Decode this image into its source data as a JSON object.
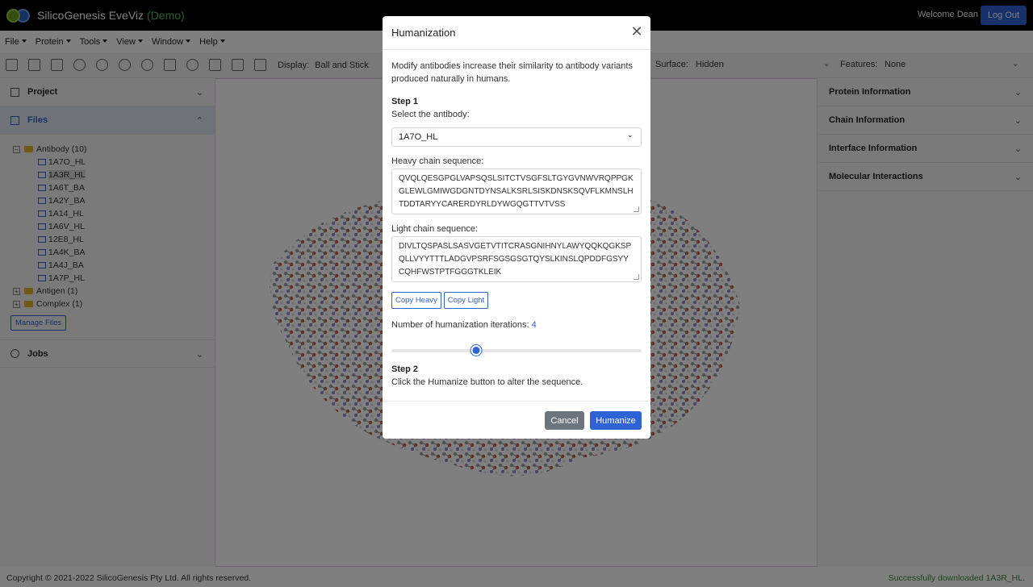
{
  "app": {
    "title": "SilicoGenesis EveViz",
    "tag": "(Demo)",
    "welcome": "Welcome Dean",
    "logout_label": "Log Out"
  },
  "menu": [
    "File",
    "Protein",
    "Tools",
    "View",
    "Window",
    "Help"
  ],
  "toolbar": {
    "display_label": "Display:",
    "display_value": "Ball and Stick",
    "surface_label": "Surface:",
    "surface_value": "Hidden",
    "features_label": "Features:",
    "features_value": "None"
  },
  "left_panel": {
    "project_label": "Project",
    "files_label": "Files",
    "jobs_label": "Jobs",
    "manage_files_label": "Manage Files",
    "tree": {
      "antibody_folder": "Antibody (10)",
      "antibody_files": [
        "1A7O_HL",
        "1A3R_HL",
        "1A6T_BA",
        "1A2Y_BA",
        "1A14_HL",
        "1A6V_HL",
        "12E8_HL",
        "1A4K_BA",
        "1A4J_BA",
        "1A7P_HL"
      ],
      "antigen_folder": "Antigen (1)",
      "complex_folder": "Complex (1)"
    }
  },
  "right_panel": {
    "sections": [
      "Protein Information",
      "Chain Information",
      "Interface Information",
      "Molecular Interactions"
    ]
  },
  "footer": {
    "copyright": "Copyright © 2021-2022 SilicoGenesis Pty Ltd. All rights reserved.",
    "status": "Successfully downloaded 1A3R_HL."
  },
  "modal": {
    "title": "Humanization",
    "description": "Modify antibodies increase their similarity to antibody variants produced naturally in humans.",
    "step1_title": "Step 1",
    "step1_text": "Select the antibody:",
    "antibody_selected": "1A7O_HL",
    "heavy_label": "Heavy chain sequence:",
    "heavy_sequence": "QVQLQESGPGLVAPSQSLSITCTVSGFSLTGYGVNWVRQPPGKGLEWLGMIWGDGNTDYNSALKSRLSISKDNSKSQVFLKMNSLHTDDTARYYCARERDYRLDYWGQGTTVTVSS",
    "light_label": "Light chain sequence:",
    "light_sequence": "DIVLTQSPASLSASVGETVTITCRASGNIHNYLAWYQQKQGKSPQLLVYYTTTLADGVPSRFSGSGSGTQYSLKINSLQPDDFGSYYCQHFWSTPTFGGGTKLEIK",
    "copy_heavy_label": "Copy Heavy",
    "copy_light_label": "Copy Light",
    "iterations_label": "Number of humanization iterations:",
    "iterations_value": "4",
    "iterations_fraction": 0.34,
    "step2_title": "Step 2",
    "step2_text": "Click the Humanize button to alter the sequence.",
    "cancel_label": "Cancel",
    "humanize_label": "Humanize"
  },
  "colors": {
    "accent": "#2e63d5",
    "success": "#3a8a3a",
    "demo": "#5cb85c"
  }
}
